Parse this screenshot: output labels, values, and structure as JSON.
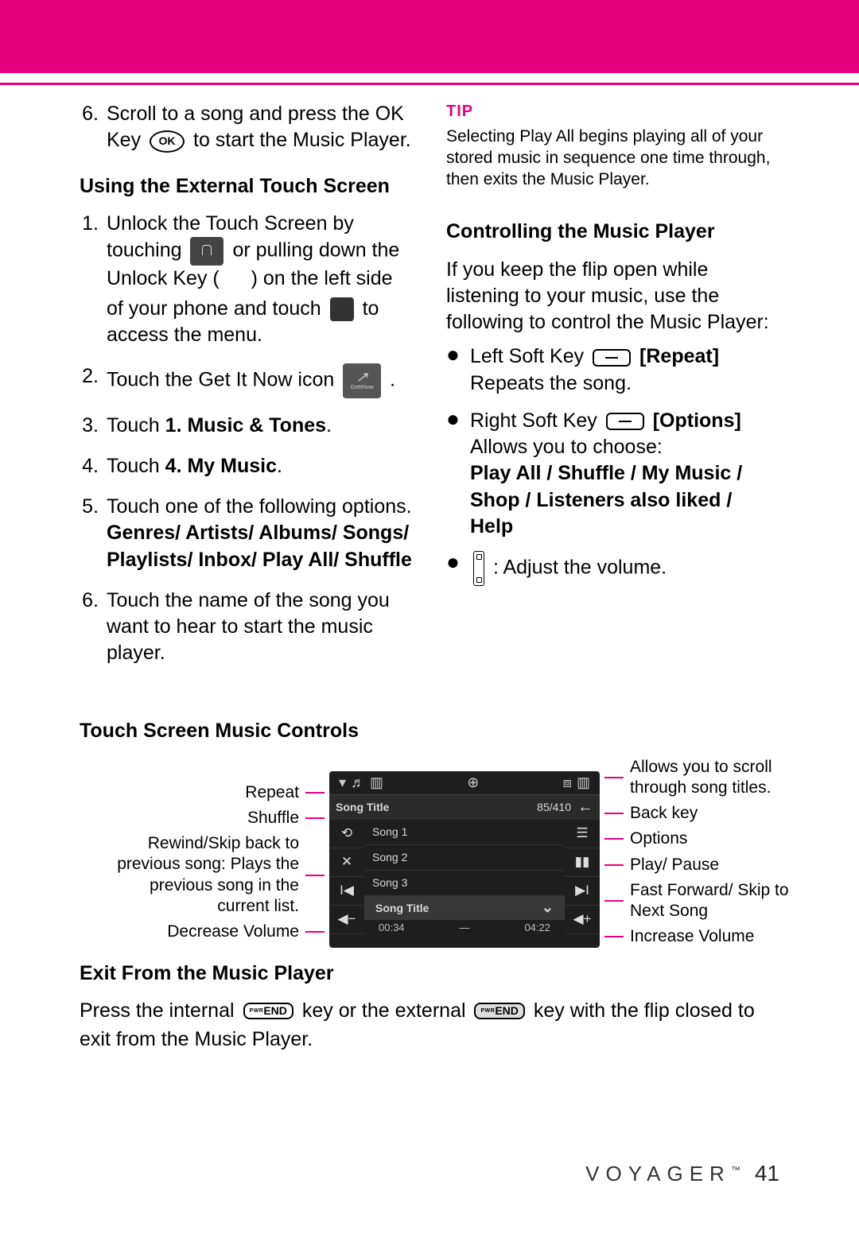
{
  "brand": "VOYAGER",
  "page_number": "41",
  "col1_step6": {
    "num": "6.",
    "t1": "Scroll to a song and press the OK Key",
    "t2": "to start the Music Player."
  },
  "touch_screen": {
    "heading": "Using the External Touch Screen",
    "s1": {
      "num": "1.",
      "a": "Unlock the Touch Screen by touching",
      "b": "or pulling down the Unlock Key (",
      "c": ") on the left side of your phone and touch",
      "d": "to access the menu."
    },
    "s2": {
      "num": "2.",
      "a": "Touch the Get It Now icon",
      "b": "."
    },
    "s3": {
      "num": "3.",
      "a": "Touch ",
      "bold": "1. Music & Tones",
      "b": "."
    },
    "s4": {
      "num": "4.",
      "a": "Touch ",
      "bold": "4. My Music",
      "b": "."
    },
    "s5": {
      "num": "5.",
      "a": "Touch one of the following options.",
      "bold": "Genres/ Artists/ Albums/ Songs/ Playlists/ Inbox/ Play All/ Shuffle"
    },
    "s6": {
      "num": "6.",
      "a": "Touch the name of the song you want to hear to start the music player."
    }
  },
  "tip": {
    "label": "TIP",
    "body": "Selecting Play All begins playing all of your stored music in sequence one time through, then exits the Music Player."
  },
  "controlling": {
    "heading": "Controlling the Music Player",
    "intro": "If you keep the flip open while listening to your music, use the following to control the Music Player:",
    "b1": {
      "a": "Left Soft Key",
      "bold": "[Repeat]",
      "b": "Repeats the song."
    },
    "b2": {
      "a": "Right Soft Key",
      "bold": "[Options]",
      "b": "Allows you to choose:",
      "bold2": "Play All / Shuffle / My Music / Shop / Listeners also liked / Help"
    },
    "b3": {
      "a": ": Adjust the volume."
    }
  },
  "shot": {
    "heading": "Touch Screen Music Controls",
    "left": {
      "repeat": "Repeat",
      "shuffle": "Shuffle",
      "rewind": "Rewind/Skip back to previous song: Plays the previous song in the current list.",
      "voldown": "Decrease Volume"
    },
    "right": {
      "scroll": "Allows you to scroll through song titles.",
      "back": "Back key",
      "options": "Options",
      "play": "Play/ Pause",
      "ff": "Fast Forward/ Skip to Next Song",
      "volup": "Increase Volume"
    },
    "screen": {
      "title_label": "Song Title",
      "counter": "85/410",
      "songs": [
        "Song 1",
        "Song 2",
        "Song 3"
      ],
      "np": "Song Title",
      "time_cur": "00:34",
      "time_total": "04:22"
    }
  },
  "exit": {
    "heading": "Exit From the Music Player",
    "a": "Press the internal",
    "b": "key or the external",
    "c": "key with the flip closed to exit from the Music Player.",
    "end_pwr": "PWR",
    "end_label": "END"
  }
}
